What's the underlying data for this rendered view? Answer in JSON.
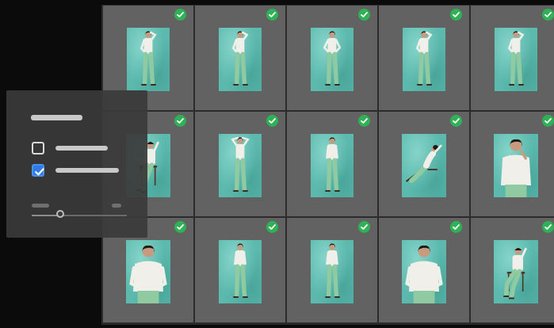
{
  "colors": {
    "background": "#0b0b0b",
    "cell": "#5f5f5f",
    "backdrop": "#5bb9ad",
    "check": "#2fb155",
    "checkbox_on": "#2f7be6",
    "panel": "#3a3a3a"
  },
  "grid": {
    "columns": 5,
    "rows": 3,
    "photos": [
      {
        "pose": "standing-hand-head",
        "selected": true,
        "icon": "check-circle-icon"
      },
      {
        "pose": "standing-hand-head",
        "selected": true,
        "icon": "check-circle-icon"
      },
      {
        "pose": "standing-hands-hips",
        "selected": true,
        "icon": "check-circle-icon"
      },
      {
        "pose": "standing-hand-head",
        "selected": true,
        "icon": "check-circle-icon"
      },
      {
        "pose": "standing-hand-head",
        "selected": true,
        "icon": "check-circle-icon"
      },
      {
        "pose": "sitting-chair",
        "selected": true,
        "icon": "check-circle-icon"
      },
      {
        "pose": "standing-arms-up",
        "selected": true,
        "icon": "check-circle-icon"
      },
      {
        "pose": "standing-hands-pockets",
        "selected": true,
        "icon": "check-circle-icon"
      },
      {
        "pose": "reclining",
        "selected": true,
        "icon": "check-circle-icon"
      },
      {
        "pose": "closeup-hand-neck",
        "selected": true,
        "icon": "check-circle-icon"
      },
      {
        "pose": "closeup-hands-hips",
        "selected": true,
        "icon": "check-circle-icon"
      },
      {
        "pose": "standing-hands-pockets",
        "selected": true,
        "icon": "check-circle-icon"
      },
      {
        "pose": "standing-hands-pockets",
        "selected": true,
        "icon": "check-circle-icon"
      },
      {
        "pose": "closeup-hands-hips",
        "selected": true,
        "icon": "check-circle-icon"
      },
      {
        "pose": "sitting-chair",
        "selected": true,
        "icon": "check-circle-icon"
      }
    ]
  },
  "panel": {
    "options": [
      {
        "checked": false,
        "icon": "checkbox-empty-icon"
      },
      {
        "checked": true,
        "icon": "checkbox-checked-icon"
      }
    ],
    "slider": {
      "value": 0.3,
      "icon": "slider-thumb-icon"
    }
  }
}
